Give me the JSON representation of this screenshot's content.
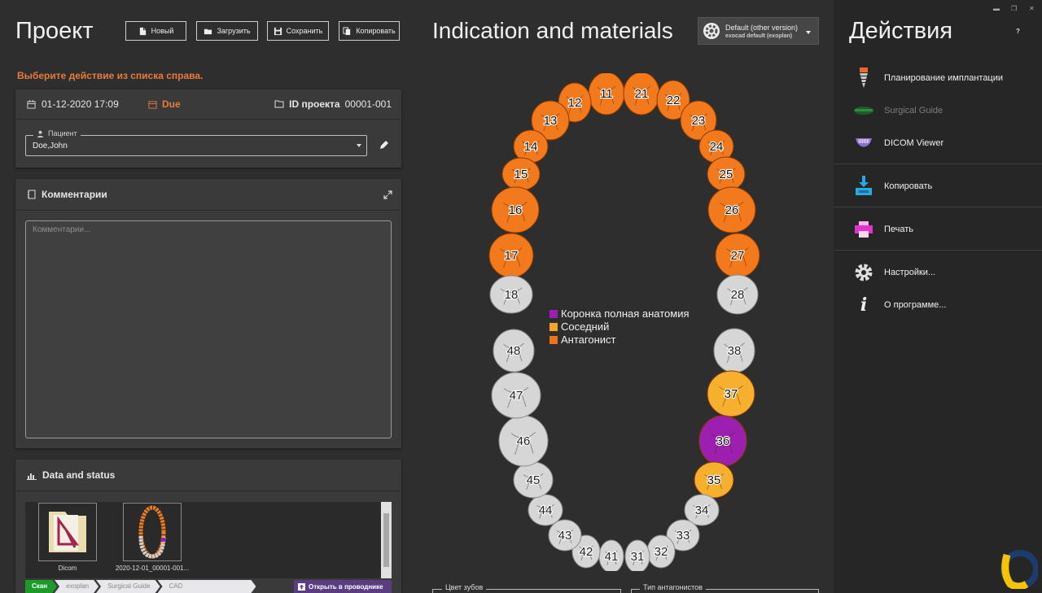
{
  "project": {
    "title": "Проект",
    "buttons": {
      "new": "Новый",
      "load": "Загрузить",
      "save": "Сохранить",
      "copy": "Копировать"
    },
    "hint": "Выберите действие из списка справа.",
    "date": "01-12-2020 17:09",
    "due": "Due",
    "project_id_label": "ID проекта",
    "project_id": "00001-001",
    "patient_label": "Пациент",
    "patient_value": "Doe,John",
    "comments_title": "Комментарии",
    "comments_placeholder": "Комментарии...",
    "data_title": "Data and status",
    "files": [
      {
        "name": "Dicom"
      },
      {
        "name": "2020-12-01_00001-001..."
      }
    ],
    "steps": [
      "Скан",
      "exoplan",
      "Surgical Guide",
      "CAD"
    ],
    "explorer_button": "Открыть в проводнике"
  },
  "center": {
    "title": "Indication and materials",
    "version_line1": "Default (other version)",
    "version_line2": "exocad default (exoplan)",
    "legend": [
      {
        "label": "Коронка полная анатомия",
        "color": "#9c1fb0"
      },
      {
        "label": "Соседний",
        "color": "#f5a623"
      },
      {
        "label": "Антагонист",
        "color": "#f07317"
      }
    ],
    "teeth_color_label": "Цвет зубов",
    "antagonist_type_label": "Тип антагонистов",
    "colors": {
      "crown": "#9c1fb0",
      "adjacent": "#f7b02e",
      "antagonist": "#f27a1c",
      "none": "#d6d6d6"
    },
    "teeth": [
      {
        "num": "11",
        "state": "antagonist"
      },
      {
        "num": "12",
        "state": "antagonist"
      },
      {
        "num": "13",
        "state": "antagonist"
      },
      {
        "num": "14",
        "state": "antagonist"
      },
      {
        "num": "15",
        "state": "antagonist"
      },
      {
        "num": "16",
        "state": "antagonist"
      },
      {
        "num": "17",
        "state": "antagonist"
      },
      {
        "num": "18",
        "state": "none"
      },
      {
        "num": "21",
        "state": "antagonist"
      },
      {
        "num": "22",
        "state": "antagonist"
      },
      {
        "num": "23",
        "state": "antagonist"
      },
      {
        "num": "24",
        "state": "antagonist"
      },
      {
        "num": "25",
        "state": "antagonist"
      },
      {
        "num": "26",
        "state": "antagonist"
      },
      {
        "num": "27",
        "state": "antagonist"
      },
      {
        "num": "28",
        "state": "none"
      },
      {
        "num": "38",
        "state": "none"
      },
      {
        "num": "37",
        "state": "adjacent"
      },
      {
        "num": "36",
        "state": "crown"
      },
      {
        "num": "35",
        "state": "adjacent"
      },
      {
        "num": "34",
        "state": "none"
      },
      {
        "num": "33",
        "state": "none"
      },
      {
        "num": "32",
        "state": "none"
      },
      {
        "num": "31",
        "state": "none"
      },
      {
        "num": "41",
        "state": "none"
      },
      {
        "num": "42",
        "state": "none"
      },
      {
        "num": "43",
        "state": "none"
      },
      {
        "num": "44",
        "state": "none"
      },
      {
        "num": "45",
        "state": "none"
      },
      {
        "num": "46",
        "state": "none"
      },
      {
        "num": "47",
        "state": "none"
      },
      {
        "num": "48",
        "state": "none"
      }
    ]
  },
  "actions": {
    "title": "Действия",
    "help": "?",
    "items": [
      {
        "label": "Планирование имплантации",
        "icon": "implant-icon"
      },
      {
        "label": "Surgical Guide",
        "icon": "surgical-guide-icon"
      },
      {
        "label": "DICOM Viewer",
        "icon": "dicom-viewer-icon"
      },
      {
        "label": "Копировать",
        "icon": "copy-download-icon"
      },
      {
        "label": "Печать",
        "icon": "printer-icon"
      },
      {
        "label": "Настройки...",
        "icon": "gear-icon"
      },
      {
        "label": "О программе...",
        "icon": "info-icon"
      }
    ]
  }
}
